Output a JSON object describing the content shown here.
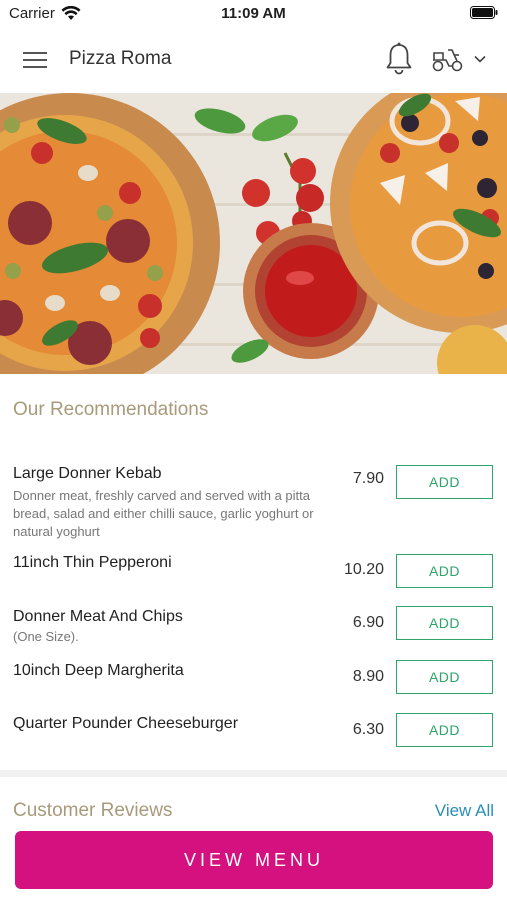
{
  "status_bar": {
    "carrier": "Carrier",
    "time": "11:09 AM"
  },
  "header": {
    "title": "Pizza Roma"
  },
  "recommendations": {
    "title": "Our Recommendations",
    "items": [
      {
        "name": "Large Donner Kebab",
        "description": "Donner meat, freshly carved and served with a pitta bread, salad and either chilli sauce, garlic yoghurt or natural yoghurt",
        "price": "7.90",
        "button": "ADD"
      },
      {
        "name": "11inch Thin Pepperoni",
        "description": "",
        "price": "10.20",
        "button": "ADD"
      },
      {
        "name": "Donner Meat And Chips",
        "description": "(One Size).",
        "price": "6.90",
        "button": "ADD"
      },
      {
        "name": "10inch Deep Margherita",
        "description": "",
        "price": "8.90",
        "button": "ADD"
      },
      {
        "name": "Quarter Pounder Cheeseburger",
        "description": "",
        "price": "6.30",
        "button": "ADD"
      }
    ]
  },
  "reviews": {
    "title": "Customer Reviews",
    "view_all": "View All"
  },
  "footer": {
    "view_menu": "VIEW MENU"
  },
  "colors": {
    "accent": "#d4117f",
    "add_green": "#2ea36a",
    "section_title": "#a89a7b",
    "link": "#2a8fb8"
  }
}
